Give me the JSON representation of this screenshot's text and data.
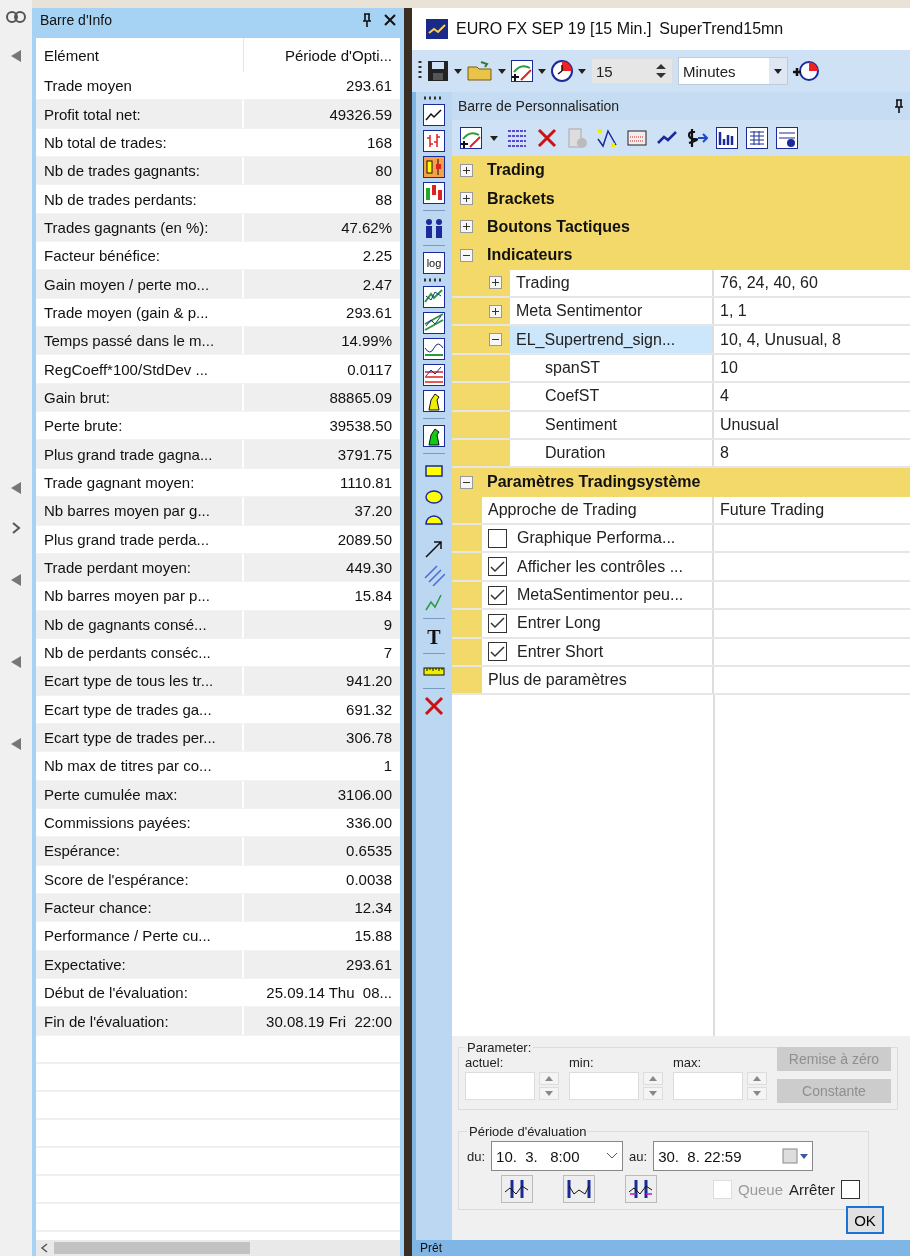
{
  "info_bar": {
    "title": "Barre d'Info",
    "columns": [
      "Elément",
      "Période d'Opti..."
    ],
    "rows": [
      {
        "label": "Trade moyen",
        "value": "293.61"
      },
      {
        "label": "Profit total net:",
        "value": "49326.59"
      },
      {
        "label": "Nb total de trades:",
        "value": "168"
      },
      {
        "label": "Nb de trades gagnants:",
        "value": "80"
      },
      {
        "label": "Nb de trades perdants:",
        "value": "88"
      },
      {
        "label": "Trades gagnants (en %):",
        "value": "47.62%"
      },
      {
        "label": "Facteur bénéfice:",
        "value": "2.25"
      },
      {
        "label": "Gain moyen / perte mo...",
        "value": "2.47"
      },
      {
        "label": "Trade moyen (gain & p...",
        "value": "293.61"
      },
      {
        "label": "Temps passé dans le m...",
        "value": "14.99%"
      },
      {
        "label": "RegCoeff*100/StdDev ...",
        "value": "0.0117"
      },
      {
        "label": "Gain brut:",
        "value": "88865.09"
      },
      {
        "label": "Perte brute:",
        "value": "39538.50"
      },
      {
        "label": "Plus grand trade gagna...",
        "value": "3791.75"
      },
      {
        "label": "Trade gagnant moyen:",
        "value": "1110.81"
      },
      {
        "label": "Nb barres moyen par g...",
        "value": "37.20"
      },
      {
        "label": "Plus grand trade perda...",
        "value": "2089.50"
      },
      {
        "label": "Trade perdant moyen:",
        "value": "449.30"
      },
      {
        "label": "Nb barres moyen par p...",
        "value": "15.84"
      },
      {
        "label": "Nb de gagnants consé...",
        "value": "9"
      },
      {
        "label": "Nb de perdants conséc...",
        "value": "7"
      },
      {
        "label": "Ecart type de tous les tr...",
        "value": "941.20"
      },
      {
        "label": "Ecart type de trades ga...",
        "value": "691.32"
      },
      {
        "label": "Ecart type de trades per...",
        "value": "306.78"
      },
      {
        "label": "Nb max de titres par co...",
        "value": "1"
      },
      {
        "label": "Perte cumulée max:",
        "value": "3106.00"
      },
      {
        "label": "Commissions payées:",
        "value": "336.00"
      },
      {
        "label": "Espérance:",
        "value": "0.6535"
      },
      {
        "label": "Score de l'espérance:",
        "value": "0.0038"
      },
      {
        "label": "Facteur chance:",
        "value": "12.34"
      },
      {
        "label": "Performance / Perte cu...",
        "value": "15.88"
      },
      {
        "label": "Expectative:",
        "value": "293.61"
      },
      {
        "label": "Début de l'évaluation:",
        "value": "25.09.14 Thu  08..."
      },
      {
        "label": "Fin de l'évaluation:",
        "value": "30.08.19 Fri  22:00"
      }
    ]
  },
  "chart_window": {
    "title": "EURO FX SEP 19 [15 Min.]",
    "subtitle": "SuperTrend15mn",
    "toolbar": {
      "interval": "15",
      "unit": "Minutes"
    },
    "drawing_tools": {
      "log_label": "log",
      "text_tool": "T"
    },
    "panel": {
      "title": "Barre de Personnalisation",
      "grid": [
        {
          "kind": "category",
          "label": "Trading",
          "expanded": false
        },
        {
          "kind": "category",
          "label": "Brackets",
          "expanded": false
        },
        {
          "kind": "category",
          "label": "Boutons Tactiques",
          "expanded": false
        },
        {
          "kind": "category",
          "label": "Indicateurs",
          "expanded": true,
          "children": [
            {
              "kind": "expandable",
              "label": "Trading",
              "value": "76, 24, 40, 60",
              "expanded": false,
              "selected": false
            },
            {
              "kind": "expandable",
              "label": "Meta Sentimentor",
              "value": "1, 1",
              "expanded": false,
              "selected": false
            },
            {
              "kind": "expandable",
              "label": "EL_Supertrend_sign...",
              "value": "10, 4, Unusual, 8",
              "expanded": true,
              "selected": true,
              "children": [
                {
                  "kind": "property",
                  "label": "spanST",
                  "value": "10",
                  "selected": false
                },
                {
                  "kind": "property",
                  "label": "CoefST",
                  "value": "4",
                  "selected": false
                },
                {
                  "kind": "property",
                  "label": "Sentiment",
                  "value": "Unusual",
                  "selected": false
                },
                {
                  "kind": "property",
                  "label": "Duration",
                  "value": "8",
                  "selected": false
                }
              ]
            }
          ]
        },
        {
          "kind": "category",
          "label": "Paramètres Tradingsystème",
          "expanded": true,
          "children": [
            {
              "kind": "property",
              "label": "Approche de Trading",
              "value": "Future Trading",
              "selected": false
            },
            {
              "kind": "checkbox",
              "label": "Graphique Performa...",
              "checked": false,
              "selected": false
            },
            {
              "kind": "checkbox",
              "label": "Afficher les contrôles ...",
              "checked": true,
              "selected": false
            },
            {
              "kind": "checkbox",
              "label": "MetaSentimentor peu...",
              "checked": true,
              "selected": false
            },
            {
              "kind": "checkbox",
              "label": "Entrer Long",
              "checked": true,
              "selected": false
            },
            {
              "kind": "checkbox",
              "label": "Entrer Short",
              "checked": true,
              "selected": false
            },
            {
              "kind": "property",
              "label": "Plus de paramètres",
              "selected": false
            }
          ]
        }
      ]
    },
    "parameter": {
      "legend": "Parameter:",
      "fields": [
        {
          "label": "actuel:"
        },
        {
          "label": "min:"
        },
        {
          "label": "max:"
        }
      ],
      "buttons": [
        {
          "label": "Remise à zéro",
          "disabled": true
        },
        {
          "label": "Constante",
          "disabled": true
        }
      ]
    },
    "evaluation": {
      "legend": "Période d'évaluation",
      "from_label": "du:",
      "from": "10.  3.   8:00",
      "to_label": "au:",
      "to": "30.  8. 22:59",
      "queue": {
        "label": "Queue",
        "checked": false,
        "disabled": true
      },
      "stop": {
        "label": "Arrêter",
        "checked": false
      },
      "ok": "OK"
    },
    "status_bar": "Prêt"
  }
}
